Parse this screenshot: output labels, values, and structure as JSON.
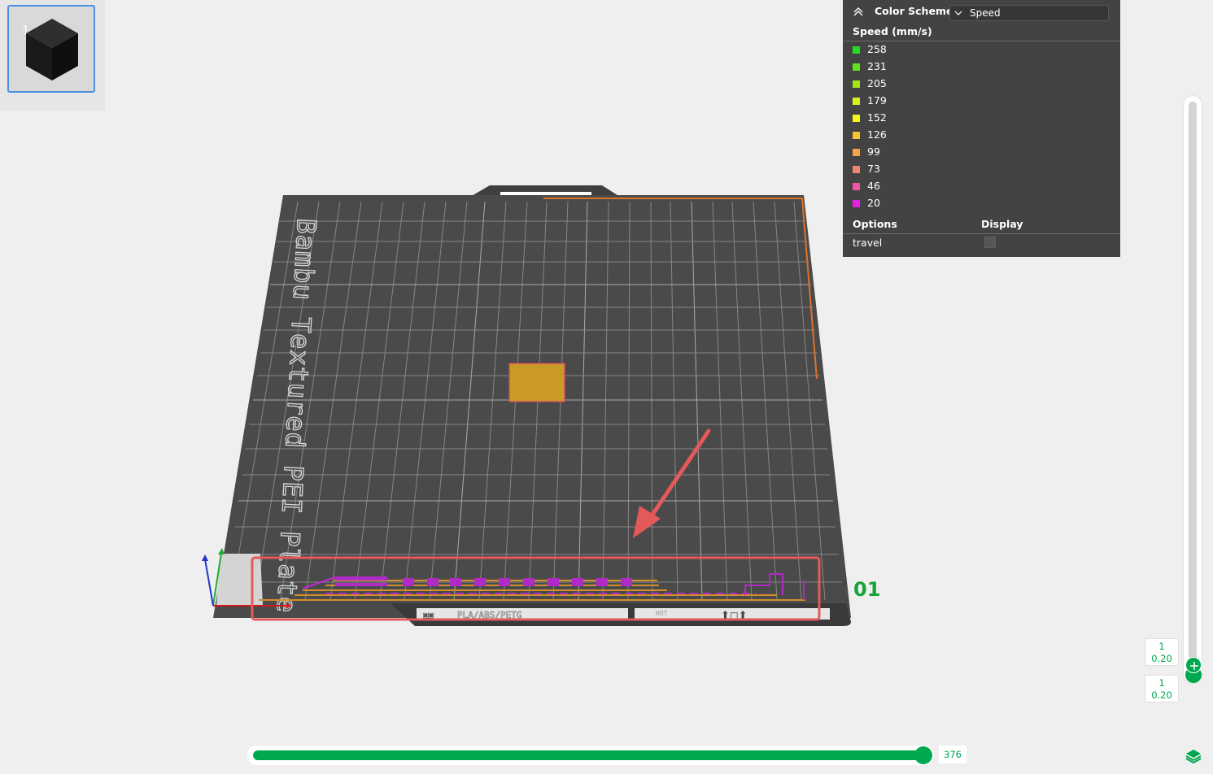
{
  "plate_list": {
    "plate_index": "1"
  },
  "legend": {
    "color_scheme_label": "Color Scheme",
    "color_scheme_value": "Speed",
    "title": "Speed (mm/s)",
    "items": [
      {
        "value": "258",
        "color": "#1ee01e"
      },
      {
        "value": "231",
        "color": "#5fe21b"
      },
      {
        "value": "205",
        "color": "#a0e619"
      },
      {
        "value": "179",
        "color": "#d6f21a"
      },
      {
        "value": "152",
        "color": "#f5f519"
      },
      {
        "value": "126",
        "color": "#f6c531"
      },
      {
        "value": "99",
        "color": "#f6a34c"
      },
      {
        "value": "73",
        "color": "#f28472"
      },
      {
        "value": "46",
        "color": "#ee55a4"
      },
      {
        "value": "20",
        "color": "#e61fe6"
      }
    ],
    "options_header": "Options",
    "display_header": "Display",
    "options": [
      {
        "label": "travel",
        "checked": false
      }
    ]
  },
  "bed": {
    "plate_name": "Bambu Textured PEI Plate",
    "plate_number": "01",
    "material_label": "PLA/ABS/PETG",
    "hot_label": "HOT"
  },
  "layer_slider": {
    "upper_layer": "1",
    "upper_height": "0.20",
    "lower_layer": "1",
    "lower_height": "0.20"
  },
  "move_slider": {
    "value": "376"
  },
  "colors": {
    "accent": "#00a84f",
    "highlight_box": "#e45a5a",
    "bed_surface": "#4a4a4a"
  }
}
